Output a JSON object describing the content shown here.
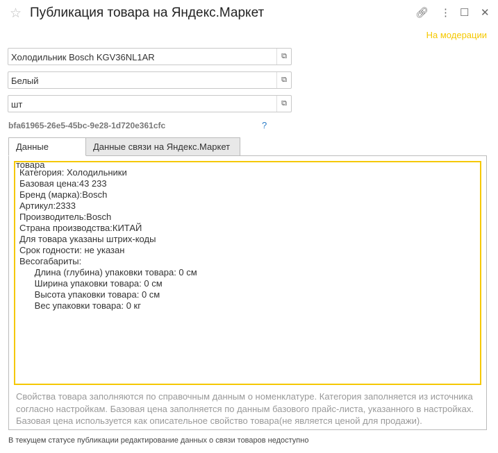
{
  "header": {
    "title": "Публикация товара на Яндекс.Маркет",
    "status": "На модерации",
    "status_color": "#f5c800"
  },
  "fields": [
    {
      "value": "Холодильник Bosch KGV36NL1AR"
    },
    {
      "value": "Белый"
    },
    {
      "value": "шт"
    }
  ],
  "guid": "bfa61965-26e5-45bc-9e28-1d720e361cfc",
  "help": "?",
  "tabs": [
    {
      "label": "Данные товара"
    },
    {
      "label": "Данные связи  на Яндекс.Маркет"
    }
  ],
  "properties": [
    "Категория: Холодильники",
    "Базовая цена:43 233",
    "Бренд (марка):Bosch",
    "Артикул:2333",
    "Производитель:Bosch",
    "Страна производства:КИТАЙ",
    "Для товара указаны штрих-коды",
    "Срок годности: не указан",
    "Весогабариты:",
    "      Длина (глубина) упаковки товара: 0 см",
    "      Ширина упаковки товара: 0 см",
    "      Высота упаковки товара: 0 см",
    "      Вес упаковки товара: 0 кг"
  ],
  "note": "Свойства товара заполняются по справочным данным о номенклатуре. Категория заполняется из источника согласно настройкам. Базовая цена заполняется по данным базового прайс-листа, указанного в настройках. Базовая цена используется как описательное свойство товара(не является ценой для продажи).",
  "footer": "В текущем статусе публикации редактирование данных о связи товаров недоступно"
}
